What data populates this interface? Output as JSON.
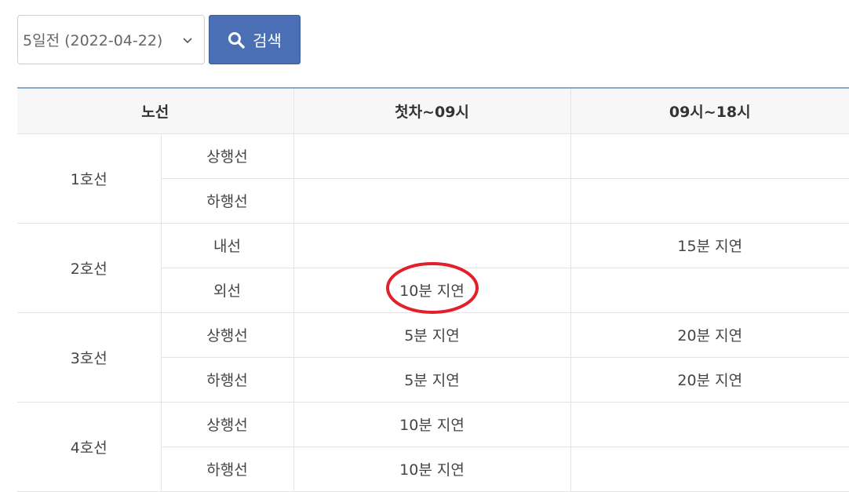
{
  "toolbar": {
    "date_select_value": "5일전 (2022-04-22)",
    "search_label": "검색"
  },
  "table": {
    "headers": {
      "line": "노선",
      "first_to_09": "첫차~09시",
      "09_to_18": "09시~18시"
    },
    "lines": [
      {
        "name": "1호선",
        "rows": [
          {
            "direction": "상행선",
            "first_to_09": "",
            "09_to_18": ""
          },
          {
            "direction": "하행선",
            "first_to_09": "",
            "09_to_18": ""
          }
        ]
      },
      {
        "name": "2호선",
        "rows": [
          {
            "direction": "내선",
            "first_to_09": "",
            "09_to_18": "15분 지연"
          },
          {
            "direction": "외선",
            "first_to_09": "10분 지연",
            "09_to_18": ""
          }
        ]
      },
      {
        "name": "3호선",
        "rows": [
          {
            "direction": "상행선",
            "first_to_09": "5분 지연",
            "09_to_18": "20분 지연"
          },
          {
            "direction": "하행선",
            "first_to_09": "5분 지연",
            "09_to_18": "20분 지연"
          }
        ]
      },
      {
        "name": "4호선",
        "rows": [
          {
            "direction": "상행선",
            "first_to_09": "10분 지연",
            "09_to_18": ""
          },
          {
            "direction": "하행선",
            "first_to_09": "10분 지연",
            "09_to_18": ""
          }
        ]
      }
    ]
  },
  "annotation": {
    "circle_color": "#e0202a"
  },
  "colors": {
    "button_bg": "#4a6fb5",
    "header_top_border": "#8aaac8"
  }
}
